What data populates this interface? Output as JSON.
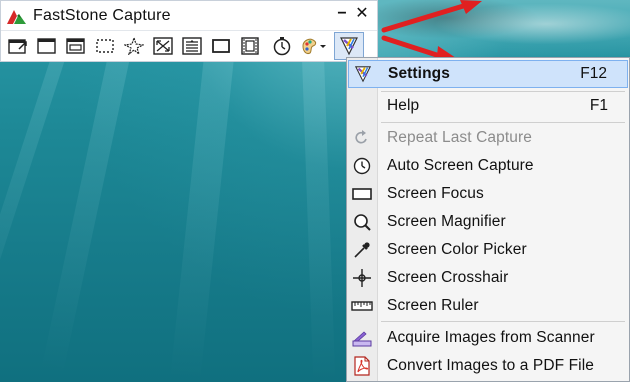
{
  "window": {
    "title": "FastStone Capture",
    "minimize_glyph": "−",
    "close_glyph": "✕"
  },
  "toolbar": {
    "buttons": [
      {
        "icon": "capture-active-window-icon"
      },
      {
        "icon": "capture-window-object-icon"
      },
      {
        "icon": "capture-window-icon"
      },
      {
        "icon": "capture-rectangular-region-icon"
      },
      {
        "icon": "capture-freehand-region-icon"
      },
      {
        "icon": "capture-full-screen-icon"
      },
      {
        "icon": "capture-scrolling-window-icon"
      },
      {
        "icon": "capture-fixed-region-icon"
      },
      {
        "icon": "screen-recorder-icon"
      },
      {
        "icon": "delay-timer-icon"
      },
      {
        "icon": "output-destination-icon"
      },
      {
        "icon": "settings-menu-icon"
      }
    ]
  },
  "menu": {
    "items": [
      {
        "label": "Settings",
        "shortcut": "F12",
        "icon": "settings-icon",
        "highlighted": true
      },
      {
        "label": "Help",
        "shortcut": "F1",
        "icon": ""
      },
      {
        "label": "Repeat Last Capture",
        "shortcut": "",
        "icon": "repeat-icon",
        "disabled": true
      },
      {
        "label": "Auto Screen Capture",
        "shortcut": "",
        "icon": "clock-icon"
      },
      {
        "label": "Screen Focus",
        "shortcut": "",
        "icon": "rectangle-icon"
      },
      {
        "label": "Screen Magnifier",
        "shortcut": "",
        "icon": "magnifier-icon"
      },
      {
        "label": "Screen Color Picker",
        "shortcut": "",
        "icon": "eyedropper-icon"
      },
      {
        "label": "Screen Crosshair",
        "shortcut": "",
        "icon": "crosshair-icon"
      },
      {
        "label": "Screen Ruler",
        "shortcut": "",
        "icon": "ruler-icon"
      },
      {
        "label": "Acquire Images from Scanner",
        "shortcut": "",
        "icon": "scanner-icon"
      },
      {
        "label": "Convert Images to a PDF File",
        "shortcut": "",
        "icon": "pdf-icon"
      }
    ]
  },
  "colors": {
    "accent_highlight": "#cfe3fb",
    "arrow_red": "#e02020",
    "water": "#1d8896"
  }
}
